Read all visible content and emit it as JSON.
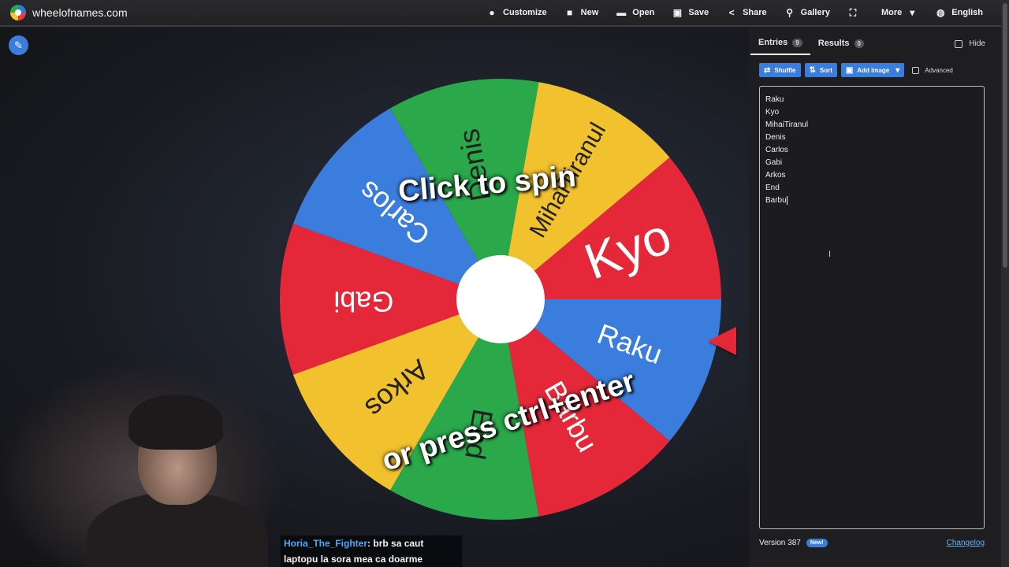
{
  "site": {
    "title": "wheelofnames.com"
  },
  "nav": [
    {
      "icon": "palette-icon",
      "glyph": "●",
      "label": "Customize"
    },
    {
      "icon": "file-icon",
      "glyph": "■",
      "label": "New"
    },
    {
      "icon": "folder-icon",
      "glyph": "▬",
      "label": "Open"
    },
    {
      "icon": "save-icon",
      "glyph": "▣",
      "label": "Save"
    },
    {
      "icon": "share-icon",
      "glyph": "<",
      "label": "Share"
    },
    {
      "icon": "search-icon",
      "glyph": "⚲",
      "label": "Gallery"
    },
    {
      "icon": "fullscreen-icon",
      "glyph": "⛶",
      "label": ""
    },
    {
      "icon": "chevron-down-icon",
      "glyph": "▾",
      "label": "More"
    },
    {
      "icon": "globe-icon",
      "glyph": "◍",
      "label": "English"
    }
  ],
  "wheel": {
    "hint_line1": "Click to spin",
    "hint_line2": "or press ctrl+enter",
    "segments": [
      {
        "label": "Raku",
        "color": "#3b7ddd"
      },
      {
        "label": "Barbu",
        "color": "#e4283a"
      },
      {
        "label": "End",
        "color": "#2aa84a"
      },
      {
        "label": "Arkos",
        "color": "#f2c12e"
      },
      {
        "label": "Gabi",
        "color": "#e4283a"
      },
      {
        "label": "Carlos",
        "color": "#3b7ddd"
      },
      {
        "label": "Denis",
        "color": "#2aa84a"
      },
      {
        "label": "MihaiTiranul",
        "color": "#f2c12e"
      },
      {
        "label": "Kyo",
        "color": "#e4283a"
      }
    ]
  },
  "panel": {
    "tabs": [
      {
        "label": "Entries",
        "count": "9"
      },
      {
        "label": "Results",
        "count": "0"
      }
    ],
    "hide_label": "Hide",
    "toolbar": {
      "shuffle": "Shuffle",
      "sort": "Sort",
      "add_image": "Add image",
      "advanced": "Advanced"
    },
    "entries": [
      "Raku",
      "Kyo",
      "MihaiTiranul",
      "Denis",
      "Carlos",
      "Gabi",
      "Arkos",
      "End",
      "Barbu"
    ],
    "version": "Version 387",
    "new_badge": "New!",
    "changelog": "Changelog"
  },
  "chat": {
    "user": "Horia_The_Fighter",
    "message": ": brb sa caut laptopu la sora mea ca doarme"
  },
  "colors": {
    "accent": "#3b7ddd",
    "red": "#e4283a",
    "green": "#2aa84a",
    "yellow": "#f2c12e",
    "blue": "#3b7ddd"
  }
}
